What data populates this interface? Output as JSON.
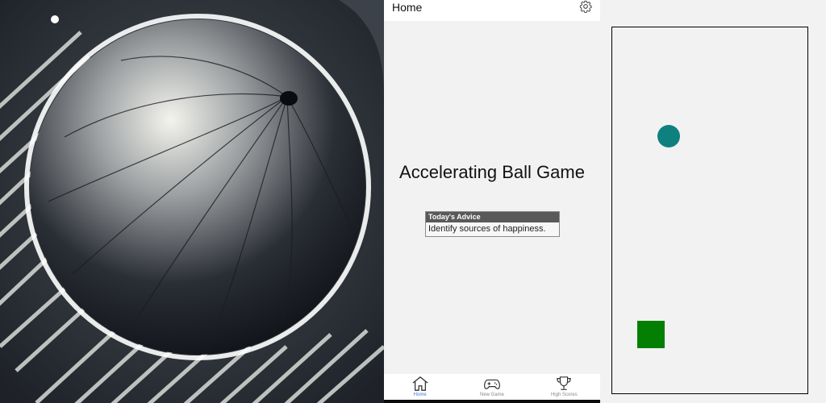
{
  "splash": {
    "artwork": "accelerating-ball-artwork"
  },
  "home": {
    "appbar_title": "Home",
    "settings_icon": "gear-icon",
    "game_title": "Accelerating Ball Game",
    "advice": {
      "heading": "Today's Advice",
      "text": "Identify sources of happiness."
    },
    "tabs": [
      {
        "label": "Home",
        "icon": "home-icon",
        "active": true
      },
      {
        "label": "New Game",
        "icon": "gamepad-icon",
        "active": false
      },
      {
        "label": "High Scores",
        "icon": "trophy-icon",
        "active": false
      }
    ]
  },
  "game": {
    "ball_color": "#0e8080",
    "paddle_color": "#038003",
    "board_border_color": "#000000"
  },
  "colors": {
    "accent": "#3b7bd6",
    "background": "#f2f2f2"
  }
}
